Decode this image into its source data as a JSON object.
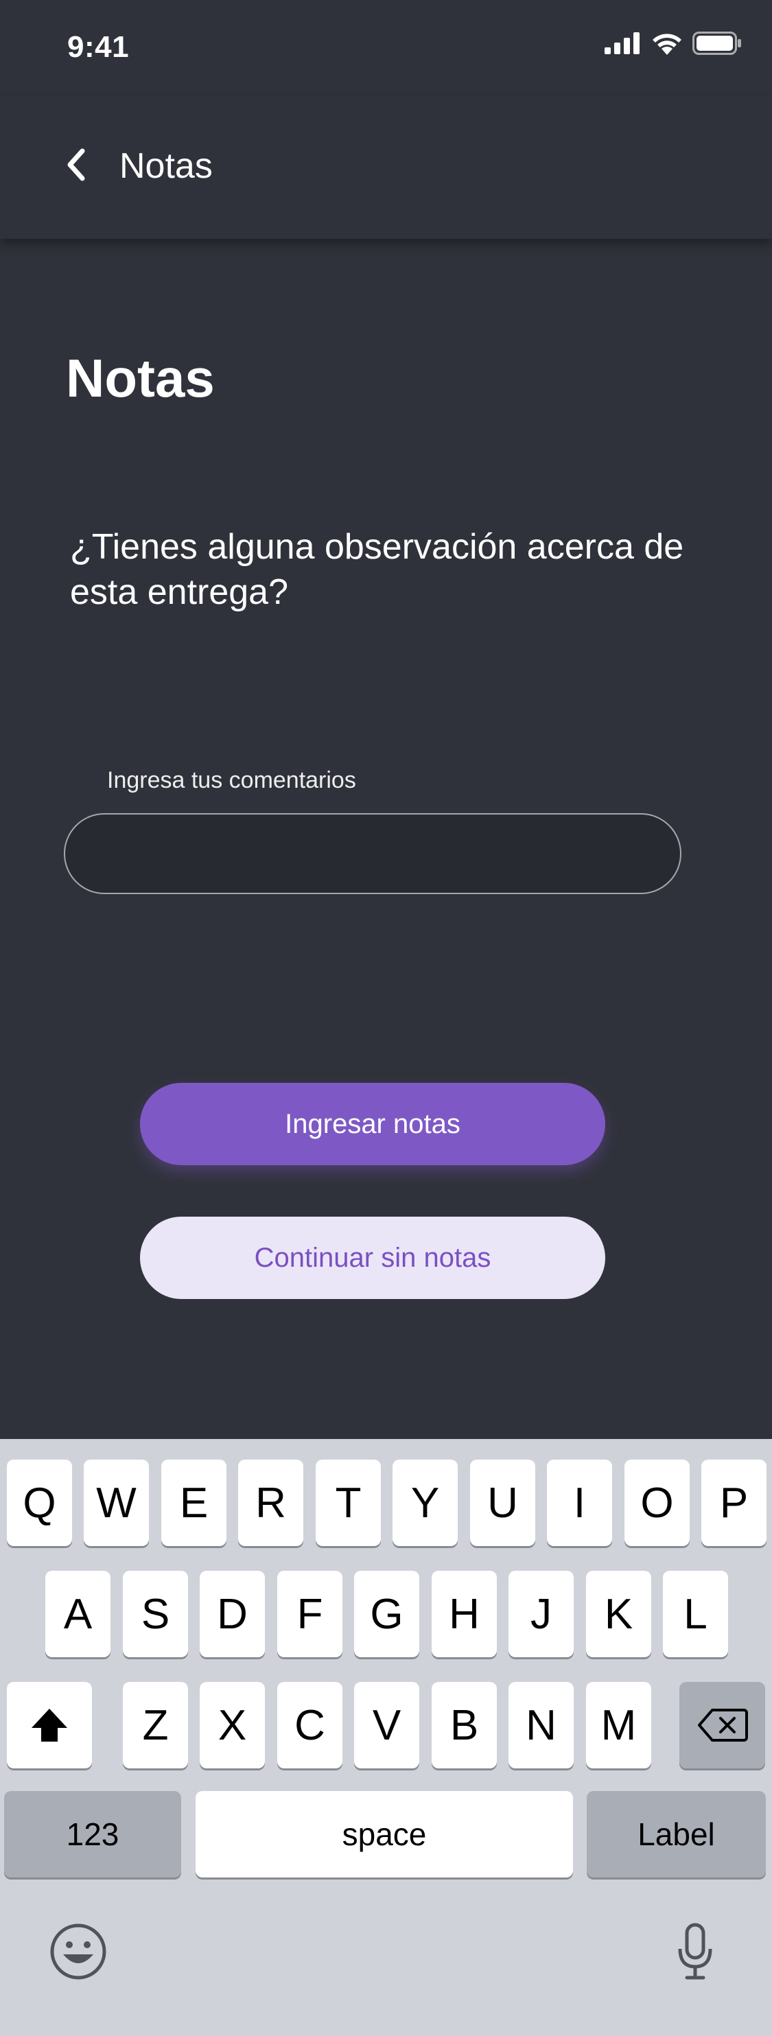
{
  "status": {
    "time": "9:41",
    "icons": [
      "signal-icon",
      "wifi-icon",
      "battery-icon"
    ]
  },
  "appbar": {
    "back_icon": "chevron-left-icon",
    "title": "Notas"
  },
  "main": {
    "title": "Notas",
    "question": "¿Tienes alguna observación acerca de esta entrega?",
    "field_label": "Ingresa tus comentarios",
    "field_value": "",
    "field_placeholder": "",
    "primary_button": "Ingresar notas",
    "secondary_button": "Continuar sin notas"
  },
  "colors": {
    "background": "#30323b",
    "accent": "#7e59c5",
    "secondary_bg": "#ebe6f7"
  },
  "keyboard": {
    "row1": [
      "Q",
      "W",
      "E",
      "R",
      "T",
      "Y",
      "U",
      "I",
      "O",
      "P"
    ],
    "row2": [
      "A",
      "S",
      "D",
      "F",
      "G",
      "H",
      "J",
      "K",
      "L"
    ],
    "row3": [
      "Z",
      "X",
      "C",
      "V",
      "B",
      "N",
      "M"
    ],
    "shift_icon": "shift-icon",
    "delete_icon": "delete-icon",
    "numbers": "123",
    "space": "space",
    "return": "Label",
    "emoji_icon": "emoji-icon",
    "mic_icon": "microphone-icon"
  }
}
